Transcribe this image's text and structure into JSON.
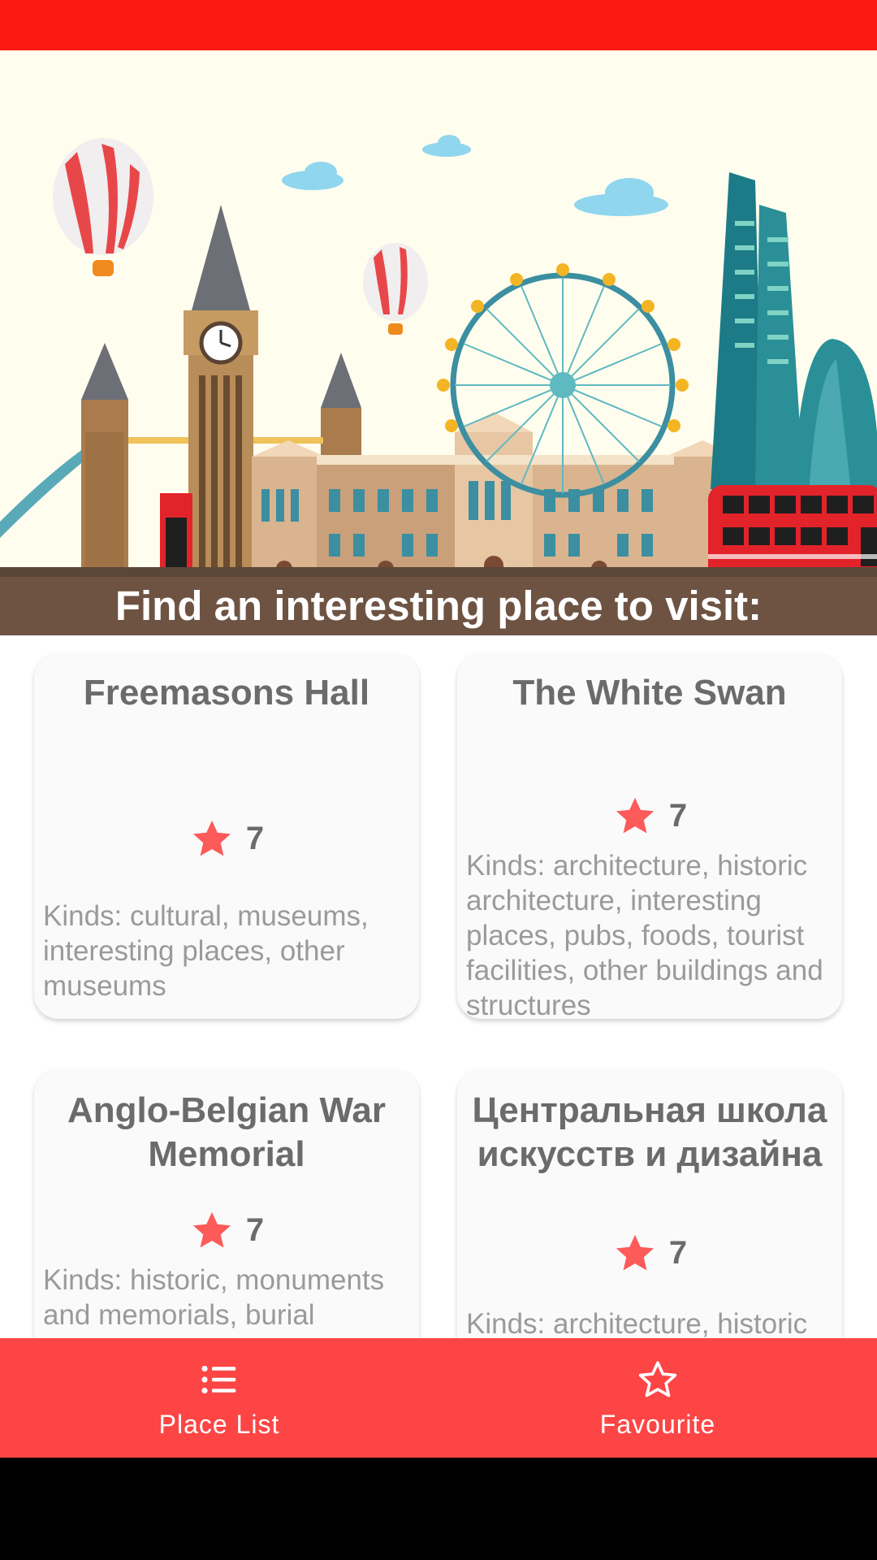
{
  "hero": {
    "caption": "Find an interesting place to visit:"
  },
  "places": [
    {
      "title": "Freemasons Hall",
      "rating": "7",
      "kinds": "Kinds: cultural, museums, interesting places, other museums"
    },
    {
      "title": "The White Swan",
      "rating": "7",
      "kinds": "Kinds: architecture, historic architecture, interesting places, pubs, foods, tourist facilities, other buildings and structures"
    },
    {
      "title": "Anglo-Belgian War Memorial",
      "rating": "7",
      "kinds": "Kinds: historic, monuments and memorials, burial"
    },
    {
      "title": "Центральная школа искусств и дизайна",
      "rating": "7",
      "kinds": "Kinds: architecture, historic"
    }
  ],
  "bottom_nav": {
    "items": [
      {
        "label": "Place List",
        "icon": "list-icon"
      },
      {
        "label": "Favourite",
        "icon": "star-outline-icon"
      }
    ]
  },
  "colors": {
    "status_bar": "#fb1a12",
    "accent": "#fd4545",
    "hero_caption_bg": "#6e5343",
    "star": "#fd5a5a"
  }
}
